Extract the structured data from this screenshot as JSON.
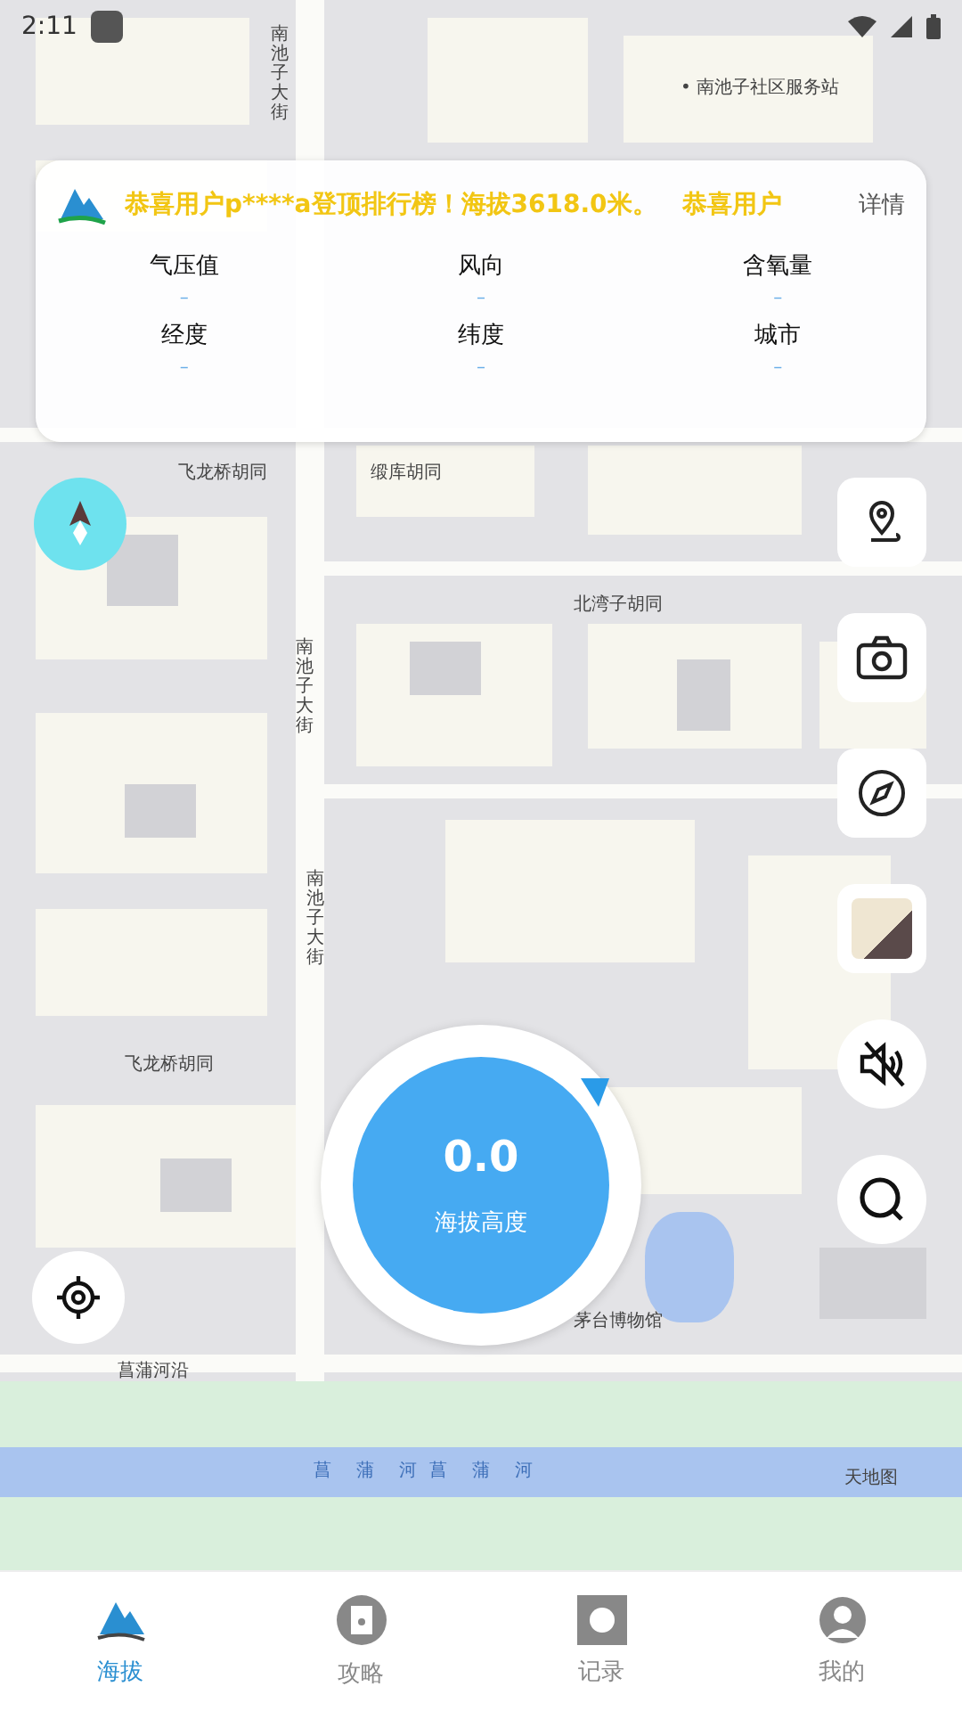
{
  "status_bar": {
    "time": "2:11"
  },
  "banner": {
    "marquee": "恭喜用户p****a登顶排行榜！海拔3618.0米。　恭喜用户",
    "details": "详情"
  },
  "stats": [
    {
      "label": "气压值",
      "value": "–"
    },
    {
      "label": "风向",
      "value": "–"
    },
    {
      "label": "含氧量",
      "value": "–"
    },
    {
      "label": "经度",
      "value": "–"
    },
    {
      "label": "纬度",
      "value": "–"
    },
    {
      "label": "城市",
      "value": "–"
    }
  ],
  "map_labels": [
    {
      "text": "南池子大街",
      "kind": "vertical"
    },
    {
      "text": "• 南池子社区服务站",
      "kind": "horizontal"
    },
    {
      "text": "飞龙桥胡同",
      "kind": "horizontal"
    },
    {
      "text": "缎库胡同",
      "kind": "horizontal"
    },
    {
      "text": "北湾子胡同",
      "kind": "horizontal"
    },
    {
      "text": "南池子大街",
      "kind": "vertical"
    },
    {
      "text": "南池子大街",
      "kind": "vertical"
    },
    {
      "text": "飞龙桥胡同",
      "kind": "horizontal"
    },
    {
      "text": "茅台博物馆",
      "kind": "horizontal"
    },
    {
      "text": "菖蒲河沿",
      "kind": "horizontal"
    },
    {
      "text": "菖　蒲　河 菖　蒲　河",
      "kind": "river"
    },
    {
      "text": "天地图",
      "kind": "horizontal"
    }
  ],
  "altitude": {
    "value": "0.0",
    "label": "海拔高度"
  },
  "tabs": [
    {
      "label": "海拔",
      "selected": true
    },
    {
      "label": "攻略",
      "selected": false
    },
    {
      "label": "记录",
      "selected": false
    },
    {
      "label": "我的",
      "selected": false
    }
  ]
}
